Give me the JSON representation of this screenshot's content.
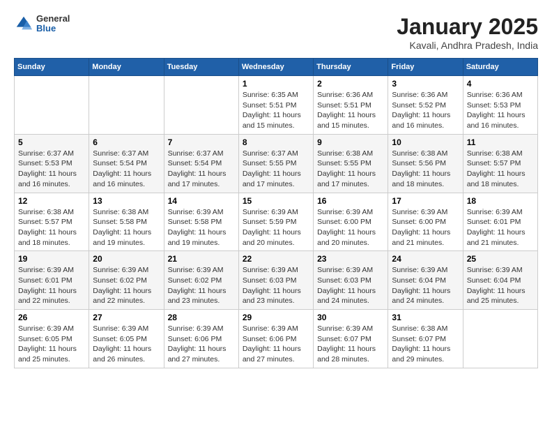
{
  "header": {
    "logo": {
      "general": "General",
      "blue": "Blue"
    },
    "title": "January 2025",
    "location": "Kavali, Andhra Pradesh, India"
  },
  "days_of_week": [
    "Sunday",
    "Monday",
    "Tuesday",
    "Wednesday",
    "Thursday",
    "Friday",
    "Saturday"
  ],
  "weeks": [
    [
      {
        "day": "",
        "info": ""
      },
      {
        "day": "",
        "info": ""
      },
      {
        "day": "",
        "info": ""
      },
      {
        "day": "1",
        "info": "Sunrise: 6:35 AM\nSunset: 5:51 PM\nDaylight: 11 hours and 15 minutes."
      },
      {
        "day": "2",
        "info": "Sunrise: 6:36 AM\nSunset: 5:51 PM\nDaylight: 11 hours and 15 minutes."
      },
      {
        "day": "3",
        "info": "Sunrise: 6:36 AM\nSunset: 5:52 PM\nDaylight: 11 hours and 16 minutes."
      },
      {
        "day": "4",
        "info": "Sunrise: 6:36 AM\nSunset: 5:53 PM\nDaylight: 11 hours and 16 minutes."
      }
    ],
    [
      {
        "day": "5",
        "info": "Sunrise: 6:37 AM\nSunset: 5:53 PM\nDaylight: 11 hours and 16 minutes."
      },
      {
        "day": "6",
        "info": "Sunrise: 6:37 AM\nSunset: 5:54 PM\nDaylight: 11 hours and 16 minutes."
      },
      {
        "day": "7",
        "info": "Sunrise: 6:37 AM\nSunset: 5:54 PM\nDaylight: 11 hours and 17 minutes."
      },
      {
        "day": "8",
        "info": "Sunrise: 6:37 AM\nSunset: 5:55 PM\nDaylight: 11 hours and 17 minutes."
      },
      {
        "day": "9",
        "info": "Sunrise: 6:38 AM\nSunset: 5:55 PM\nDaylight: 11 hours and 17 minutes."
      },
      {
        "day": "10",
        "info": "Sunrise: 6:38 AM\nSunset: 5:56 PM\nDaylight: 11 hours and 18 minutes."
      },
      {
        "day": "11",
        "info": "Sunrise: 6:38 AM\nSunset: 5:57 PM\nDaylight: 11 hours and 18 minutes."
      }
    ],
    [
      {
        "day": "12",
        "info": "Sunrise: 6:38 AM\nSunset: 5:57 PM\nDaylight: 11 hours and 18 minutes."
      },
      {
        "day": "13",
        "info": "Sunrise: 6:38 AM\nSunset: 5:58 PM\nDaylight: 11 hours and 19 minutes."
      },
      {
        "day": "14",
        "info": "Sunrise: 6:39 AM\nSunset: 5:58 PM\nDaylight: 11 hours and 19 minutes."
      },
      {
        "day": "15",
        "info": "Sunrise: 6:39 AM\nSunset: 5:59 PM\nDaylight: 11 hours and 20 minutes."
      },
      {
        "day": "16",
        "info": "Sunrise: 6:39 AM\nSunset: 6:00 PM\nDaylight: 11 hours and 20 minutes."
      },
      {
        "day": "17",
        "info": "Sunrise: 6:39 AM\nSunset: 6:00 PM\nDaylight: 11 hours and 21 minutes."
      },
      {
        "day": "18",
        "info": "Sunrise: 6:39 AM\nSunset: 6:01 PM\nDaylight: 11 hours and 21 minutes."
      }
    ],
    [
      {
        "day": "19",
        "info": "Sunrise: 6:39 AM\nSunset: 6:01 PM\nDaylight: 11 hours and 22 minutes."
      },
      {
        "day": "20",
        "info": "Sunrise: 6:39 AM\nSunset: 6:02 PM\nDaylight: 11 hours and 22 minutes."
      },
      {
        "day": "21",
        "info": "Sunrise: 6:39 AM\nSunset: 6:02 PM\nDaylight: 11 hours and 23 minutes."
      },
      {
        "day": "22",
        "info": "Sunrise: 6:39 AM\nSunset: 6:03 PM\nDaylight: 11 hours and 23 minutes."
      },
      {
        "day": "23",
        "info": "Sunrise: 6:39 AM\nSunset: 6:03 PM\nDaylight: 11 hours and 24 minutes."
      },
      {
        "day": "24",
        "info": "Sunrise: 6:39 AM\nSunset: 6:04 PM\nDaylight: 11 hours and 24 minutes."
      },
      {
        "day": "25",
        "info": "Sunrise: 6:39 AM\nSunset: 6:04 PM\nDaylight: 11 hours and 25 minutes."
      }
    ],
    [
      {
        "day": "26",
        "info": "Sunrise: 6:39 AM\nSunset: 6:05 PM\nDaylight: 11 hours and 25 minutes."
      },
      {
        "day": "27",
        "info": "Sunrise: 6:39 AM\nSunset: 6:05 PM\nDaylight: 11 hours and 26 minutes."
      },
      {
        "day": "28",
        "info": "Sunrise: 6:39 AM\nSunset: 6:06 PM\nDaylight: 11 hours and 27 minutes."
      },
      {
        "day": "29",
        "info": "Sunrise: 6:39 AM\nSunset: 6:06 PM\nDaylight: 11 hours and 27 minutes."
      },
      {
        "day": "30",
        "info": "Sunrise: 6:39 AM\nSunset: 6:07 PM\nDaylight: 11 hours and 28 minutes."
      },
      {
        "day": "31",
        "info": "Sunrise: 6:38 AM\nSunset: 6:07 PM\nDaylight: 11 hours and 29 minutes."
      },
      {
        "day": "",
        "info": ""
      }
    ]
  ]
}
